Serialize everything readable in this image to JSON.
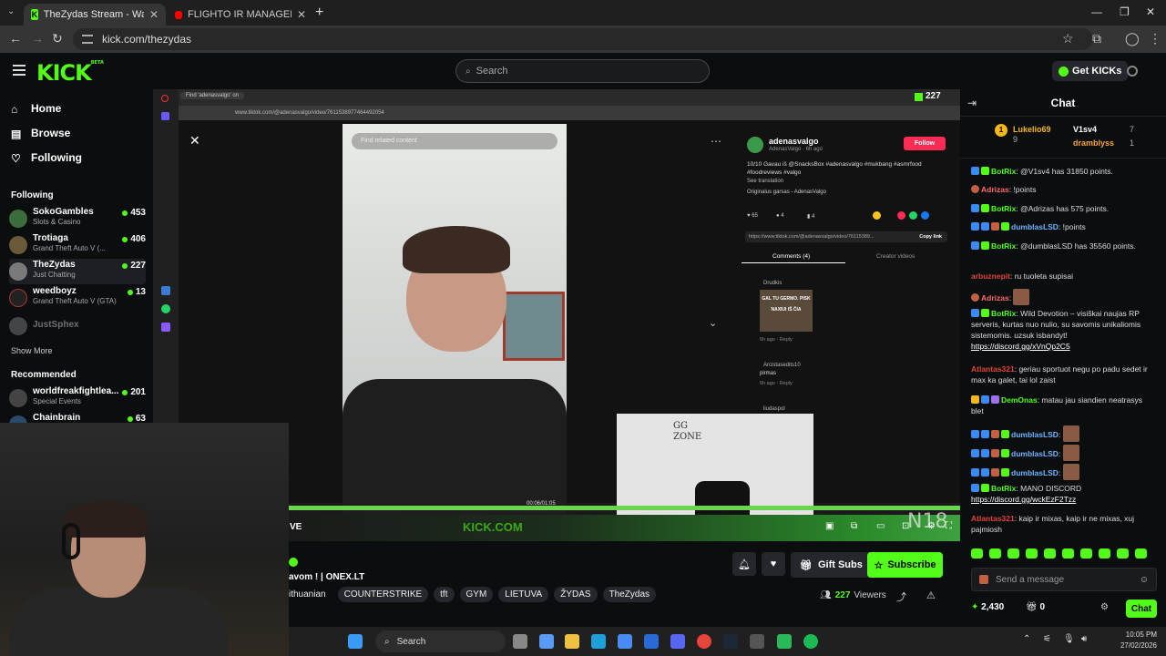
{
  "browser": {
    "tabs": [
      {
        "title": "TheZydas Stream - Watch Live o..."
      },
      {
        "title": "FLIGHTO IR MANAGERIO PIRM..."
      }
    ],
    "url": "kick.com/thezydas"
  },
  "kick": {
    "logo": "KICK",
    "beta": "BETA",
    "search_placeholder": "Search",
    "get_kicks": "Get KICKs"
  },
  "sidebar": {
    "nav": [
      {
        "label": "Home",
        "icon": "home-icon"
      },
      {
        "label": "Browse",
        "icon": "browse-icon"
      },
      {
        "label": "Following",
        "icon": "heart-icon"
      }
    ],
    "following_title": "Following",
    "following": [
      {
        "name": "SokoGambles",
        "category": "Slots & Casino",
        "viewers": "453"
      },
      {
        "name": "Trotiaga",
        "category": "Grand Theft Auto V (...",
        "viewers": "406"
      },
      {
        "name": "TheZydas",
        "category": "Just Chatting",
        "viewers": "227"
      },
      {
        "name": "weedboyz",
        "category": "Grand Theft Auto V (GTA)",
        "viewers": "13"
      },
      {
        "name": "JustSphex",
        "category": "",
        "viewers": ""
      }
    ],
    "show_more": "Show More",
    "recommended_title": "Recommended",
    "recommended": [
      {
        "name": "worldfreakfightlea...",
        "category": "Special Events",
        "viewers": "201"
      },
      {
        "name": "Chainbrain",
        "category": "",
        "viewers": "63"
      }
    ]
  },
  "video": {
    "inner_tab": "Find 'adenasvalgo' on",
    "inner_url": "www.tiktok.com/@adenasvalgo/video/7611538977464492054",
    "viewer_count": "227",
    "tt_search": "Find related content",
    "tt_author": "adenasvalgo",
    "tt_author_sub": "AdenasValgo · 6h ago",
    "tt_follow": "Follow",
    "tt_caption": "10/10 Gavau iš @SnacksBox #adenasvalgo #mukbang #asmrfood #foodreviews #valgo",
    "tt_see_translation": "See translation",
    "tt_sound": "Originalus garsas - AdenasValgo",
    "tt_likes": "65",
    "tt_comments_count": "4",
    "tt_saves": "4",
    "tt_link": "https://www.tiktok.com/@adenasvalgo/video/76115389...",
    "tt_copy": "Copy link",
    "tt_tab_comments": "Comments (4)",
    "tt_tab_creator": "Creator videos",
    "tt_comment1_user": "Drudkis",
    "tt_comment1_meme": "GAL TU GERMO. PISK NAXIUI IŠ ČIA",
    "tt_comment1_meta": "6h ago · Reply",
    "tt_comment2_user": "Arcistasedits10",
    "tt_comment2_text": "pirmas",
    "tt_comment2_meta": "6h ago · Reply",
    "tt_comment3_user": "liudaspol",
    "tt_time": "00:06/01:05",
    "gg_zone": "GG ZONE",
    "overlay_text": "VE",
    "kick_watermark": "KICK.COM",
    "n18": "N18"
  },
  "stream": {
    "title": "avom ! | ONEX.LT",
    "tags": [
      "ithuanian",
      "COUNTERSTRIKE",
      "tft",
      "GYM",
      "LIETUVA",
      "ŽYDAS",
      "TheZydas"
    ],
    "gift_subs": "Gift Subs",
    "subscribe": "Subscribe",
    "viewers": "227",
    "viewers_label": "Viewers"
  },
  "taskbar": {
    "search": "Search",
    "time": "10:05 PM",
    "date": "27/02/2026"
  },
  "chat": {
    "title": "Chat",
    "leaders": [
      {
        "name": "Lukelio69",
        "count": "9",
        "rank": "1"
      },
      {
        "name": "V1sv4",
        "count": "7"
      },
      {
        "name": "dramblyss",
        "count": "1"
      }
    ],
    "messages": [
      {
        "user": "BotRix",
        "color": "#53fc18",
        "text": ": @V1sv4 has 31850 points."
      },
      {
        "user": "Adrizas",
        "color": "#ff6b6b",
        "text": ": !points"
      },
      {
        "user": "BotRix",
        "color": "#53fc18",
        "text": ": @Adrizas has 575 points."
      },
      {
        "user": "dumblasLSD",
        "color": "#6fb4ff",
        "text": ": !points"
      },
      {
        "user": "BotRix",
        "color": "#53fc18",
        "text": ": @dumblasLSD has 35560 points."
      },
      {
        "user": "arbuznepit",
        "color": "#e0443a",
        "text": ": ru tuoleta supisai"
      },
      {
        "user": "Adrizas",
        "color": "#ff6b6b",
        "text": ":"
      },
      {
        "user": "BotRix",
        "color": "#53fc18",
        "text": ": Wild Devotion – visiškai naujas RP serveris, kurtas nuo nulio, su savomis unikaliomis sistemomis. uzsuk isbandyt!",
        "link": "https://discord.gg/xVnQp2C5"
      },
      {
        "user": "Atlantas321",
        "color": "#e0443a",
        "text": ": geriau sportuot negu po padu sedet ir max ka galet, tai lol zaist"
      },
      {
        "user": "DemOnas",
        "color": "#53fc18",
        "text": ": matau jau siandien neatrasys blet"
      },
      {
        "user": "dumblasLSD",
        "color": "#6fb4ff",
        "text": ":"
      },
      {
        "user": "dumblasLSD",
        "color": "#6fb4ff",
        "text": ":"
      },
      {
        "user": "dumblasLSD",
        "color": "#6fb4ff",
        "text": ":"
      },
      {
        "user": "BotRix",
        "color": "#53fc18",
        "text": ": MANO DISCORD",
        "link": "https://discord.gg/wckEzF2Tzz"
      },
      {
        "user": "Atlantas321",
        "color": "#e0443a",
        "text": ": kaip ir mixas, kaip ir ne mixas, xuj pajmiosh"
      }
    ],
    "input_placeholder": "Send a message",
    "points": "2,430",
    "gifts": "0",
    "send": "Chat"
  }
}
